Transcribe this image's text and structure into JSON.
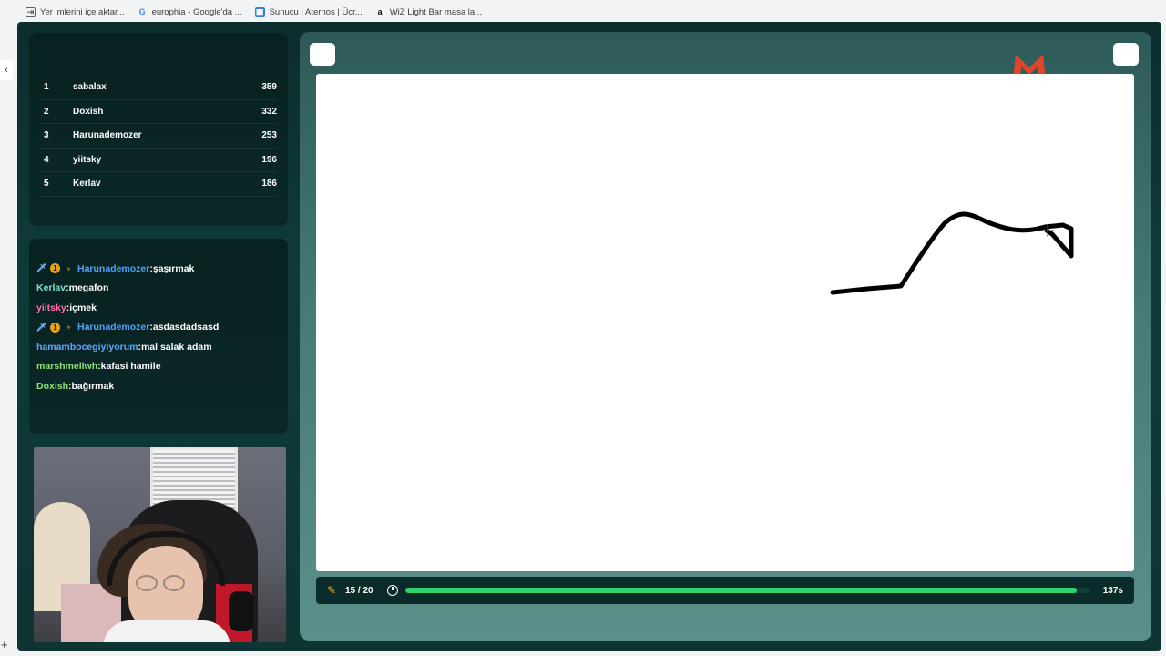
{
  "bookmarks": [
    {
      "label": "Yer imlerini içe aktar...",
      "icon": "import-icon"
    },
    {
      "label": "europhia - Google'da ...",
      "icon": "google-icon"
    },
    {
      "label": "Sunucu | Aternos | Ücr...",
      "icon": "server-icon"
    },
    {
      "label": "WiZ Light Bar masa la...",
      "icon": "amazon-icon"
    }
  ],
  "leaderboard": [
    {
      "rank": "1",
      "name": "sabalax",
      "score": "359"
    },
    {
      "rank": "2",
      "name": "Doxish",
      "score": "332"
    },
    {
      "rank": "3",
      "name": "Harunademozer",
      "score": "253"
    },
    {
      "rank": "4",
      "name": "yiitsky",
      "score": "196"
    },
    {
      "rank": "5",
      "name": "Kerlav",
      "score": "186"
    }
  ],
  "chat": [
    {
      "user": "Harunademozer",
      "message": "şaşırmak",
      "color": "#4aa3ff",
      "badges": true
    },
    {
      "user": "Kerlav",
      "message": "megafon",
      "color": "#7fe0d0",
      "badges": false
    },
    {
      "user": "yiitsky",
      "message": "içmek",
      "color": "#ff6fa8",
      "badges": false
    },
    {
      "user": "Harunademozer",
      "message": "asdasdadsasd",
      "color": "#4aa3ff",
      "badges": true
    },
    {
      "user": "hamambocegiyiyorum",
      "message": "mal salak adam",
      "color": "#5fa8ff",
      "badges": false
    },
    {
      "user": "marshmellwh",
      "message": "kafasi hamile",
      "color": "#8fe37a",
      "badges": false
    },
    {
      "user": "Doxish",
      "message": "bağırmak",
      "color": "#8fe37a",
      "badges": false
    }
  ],
  "status": {
    "round": "15 / 20",
    "time_left": "137s",
    "progress_fraction": 0.98
  },
  "colors": {
    "accent_green": "#2fd36b",
    "brand_red": "#e0452a"
  }
}
